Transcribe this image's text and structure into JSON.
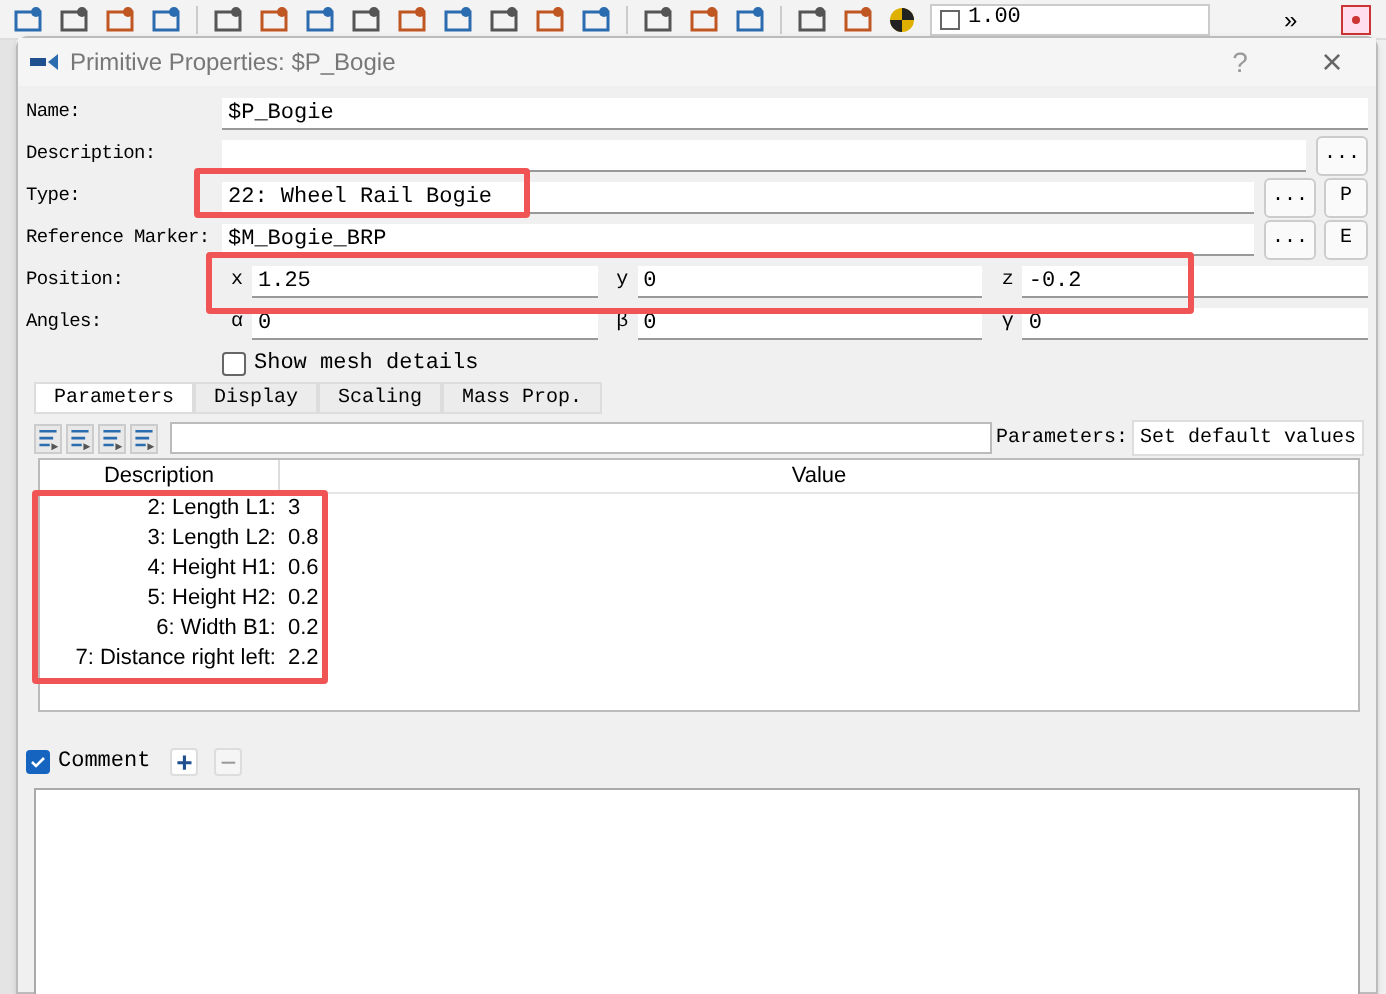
{
  "toolbar": {
    "scale_value": "1.00",
    "overflow": "»"
  },
  "dialog": {
    "title": "Primitive Properties: $P_Bogie",
    "help": "?",
    "close": "×"
  },
  "fields": [
    {
      "kind": "text",
      "label": "Name:",
      "value": "$P_Bogie"
    },
    {
      "kind": "browse",
      "label": "Description:",
      "button": "..."
    },
    {
      "kind": "browse2",
      "label": "Type:",
      "value": "22: Wheel Rail Bogie",
      "button": "...",
      "extra": "P"
    },
    {
      "kind": "browse2",
      "label": "Reference Marker:",
      "value": "$M_Bogie_BRP",
      "button": "...",
      "extra": "E"
    },
    {
      "kind": "triple",
      "label": "Position:",
      "parts": [
        {
          "axis": "x",
          "value": "1.25"
        },
        {
          "axis": "y",
          "value": "0"
        },
        {
          "axis": "z",
          "value": "-0.2"
        }
      ]
    },
    {
      "kind": "triple",
      "label": "Angles:",
      "parts": [
        {
          "axis": "α",
          "value": "0"
        },
        {
          "axis": "β",
          "value": "0"
        },
        {
          "axis": "γ",
          "value": "0"
        }
      ]
    }
  ],
  "show_mesh_details": {
    "label": "Show mesh details",
    "checked": false
  },
  "tabs": [
    {
      "label": "Parameters",
      "selected": true
    },
    {
      "label": "Display",
      "selected": false
    },
    {
      "label": "Scaling",
      "selected": false
    },
    {
      "label": "Mass Prop.",
      "selected": false
    }
  ],
  "param_bar": {
    "label": "Parameters:",
    "button": "Set default values"
  },
  "table": {
    "columns": [
      "Description",
      "Value"
    ],
    "rows": [
      {
        "description": "2: Length L1:",
        "value": "3"
      },
      {
        "description": "3: Length L2:",
        "value": "0.8"
      },
      {
        "description": "4: Height H1:",
        "value": "0.6"
      },
      {
        "description": "5: Height H2:",
        "value": "0.2"
      },
      {
        "description": "6: Width B1:",
        "value": "0.2"
      },
      {
        "description": "7: Distance right left:",
        "value": "2.2"
      }
    ]
  },
  "comment": {
    "label": "Comment",
    "checked": true,
    "add": "+",
    "remove": "−"
  }
}
